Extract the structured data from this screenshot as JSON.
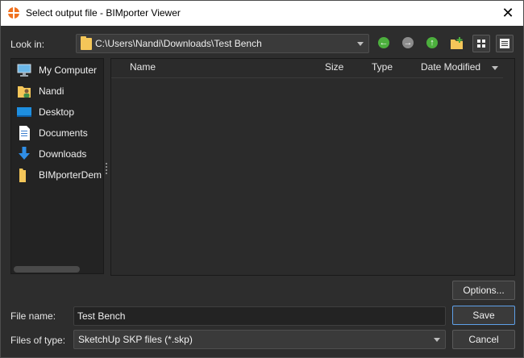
{
  "window": {
    "title": "Select output file - BIMporter Viewer",
    "close_glyph": "✕"
  },
  "toolbar": {
    "look_in_label": "Look in:",
    "path": "C:\\Users\\Nandi\\Downloads\\Test Bench",
    "back_glyph": "←",
    "forward_glyph": "→",
    "up_glyph": "↑"
  },
  "sidebar": {
    "items": [
      {
        "label": "My Computer",
        "icon": "computer-icon"
      },
      {
        "label": "Nandi",
        "icon": "user-folder-icon"
      },
      {
        "label": "Desktop",
        "icon": "desktop-icon"
      },
      {
        "label": "Documents",
        "icon": "documents-icon"
      },
      {
        "label": "Downloads",
        "icon": "downloads-icon"
      },
      {
        "label": "BIMporterDem",
        "icon": "folder-icon"
      }
    ]
  },
  "file_list": {
    "columns": [
      "Name",
      "Size",
      "Type",
      "Date Modified"
    ],
    "rows": []
  },
  "footer": {
    "options_label": "Options...",
    "file_name_label": "File name:",
    "file_name_value": "Test Bench",
    "files_of_type_label": "Files of type:",
    "files_of_type_value": "SketchUp SKP files (*.skp)",
    "save_label": "Save",
    "cancel_label": "Cancel"
  },
  "colors": {
    "background": "#2d2d2d",
    "panel": "#2b2b2b",
    "accent": "#5ea0e8",
    "app_icon": "#f0711f",
    "folder": "#f4c659",
    "nav_green": "#4caf3d"
  }
}
